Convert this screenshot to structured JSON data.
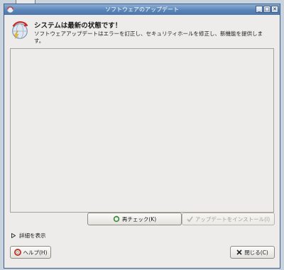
{
  "window": {
    "title": "ソフトウェアのアップデート",
    "minimize_glyph": "_",
    "maximize_glyph": "□",
    "close_glyph": "✕"
  },
  "header": {
    "heading": "システムは最新の状態です！",
    "description": "ソフトウェアアップデートはエラーを訂正し、セキュリティホールを修正し、新機能を提供します。",
    "icon": "globe-update-icon"
  },
  "updates_list": {
    "items": []
  },
  "buttons": {
    "recheck_label": "再チェック(K)",
    "install_label": "アップデートをインストール(I)",
    "help_label": "ヘルプ(H)",
    "close_label": "閉じる(C)"
  },
  "details": {
    "label": "詳細を表示",
    "expanded": false
  },
  "colors": {
    "titlebar": "#5b85b8",
    "window_bg": "#edeceb",
    "border": "#3f5d85"
  }
}
